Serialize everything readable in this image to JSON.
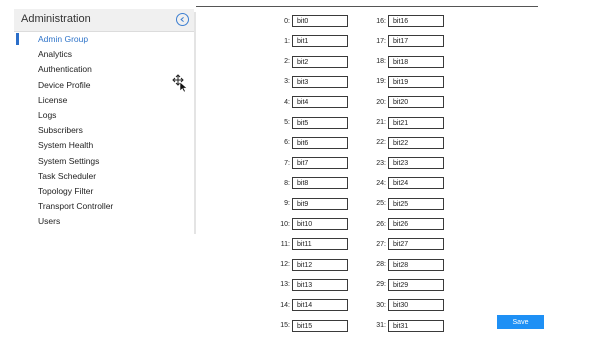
{
  "sidebar": {
    "title": "Administration",
    "items": [
      {
        "label": "Admin Group",
        "active": true
      },
      {
        "label": "Analytics"
      },
      {
        "label": "Authentication"
      },
      {
        "label": "Device Profile"
      },
      {
        "label": "License"
      },
      {
        "label": "Logs"
      },
      {
        "label": "Subscribers"
      },
      {
        "label": "System Health"
      },
      {
        "label": "System Settings"
      },
      {
        "label": "Task Scheduler"
      },
      {
        "label": "Topology Filter"
      },
      {
        "label": "Transport Controller"
      },
      {
        "label": "Users"
      }
    ]
  },
  "bits": {
    "left": [
      {
        "num": "0:",
        "value": "bit0"
      },
      {
        "num": "1:",
        "value": "bit1"
      },
      {
        "num": "2:",
        "value": "bit2"
      },
      {
        "num": "3:",
        "value": "bit3"
      },
      {
        "num": "4:",
        "value": "bit4"
      },
      {
        "num": "5:",
        "value": "bit5"
      },
      {
        "num": "6:",
        "value": "bit6"
      },
      {
        "num": "7:",
        "value": "bit7"
      },
      {
        "num": "8:",
        "value": "bit8"
      },
      {
        "num": "9:",
        "value": "bit9"
      },
      {
        "num": "10:",
        "value": "bit10"
      },
      {
        "num": "11:",
        "value": "bit11"
      },
      {
        "num": "12:",
        "value": "bit12"
      },
      {
        "num": "13:",
        "value": "bit13"
      },
      {
        "num": "14:",
        "value": "bit14"
      },
      {
        "num": "15:",
        "value": "bit15"
      }
    ],
    "right": [
      {
        "num": "16:",
        "value": "bit16"
      },
      {
        "num": "17:",
        "value": "bit17"
      },
      {
        "num": "18:",
        "value": "bit18"
      },
      {
        "num": "19:",
        "value": "bit19"
      },
      {
        "num": "20:",
        "value": "bit20"
      },
      {
        "num": "21:",
        "value": "bit21"
      },
      {
        "num": "22:",
        "value": "bit22"
      },
      {
        "num": "23:",
        "value": "bit23"
      },
      {
        "num": "24:",
        "value": "bit24"
      },
      {
        "num": "25:",
        "value": "bit25"
      },
      {
        "num": "26:",
        "value": "bit26"
      },
      {
        "num": "27:",
        "value": "bit27"
      },
      {
        "num": "28:",
        "value": "bit28"
      },
      {
        "num": "29:",
        "value": "bit29"
      },
      {
        "num": "30:",
        "value": "bit30"
      },
      {
        "num": "31:",
        "value": "bit31"
      }
    ]
  },
  "save_label": "Save",
  "icons": {
    "collapse": "chevron-left-circle-icon",
    "cursor": "move-cursor-icon"
  },
  "colors": {
    "accent": "#2f74c9",
    "save_button": "#1e90f5"
  }
}
